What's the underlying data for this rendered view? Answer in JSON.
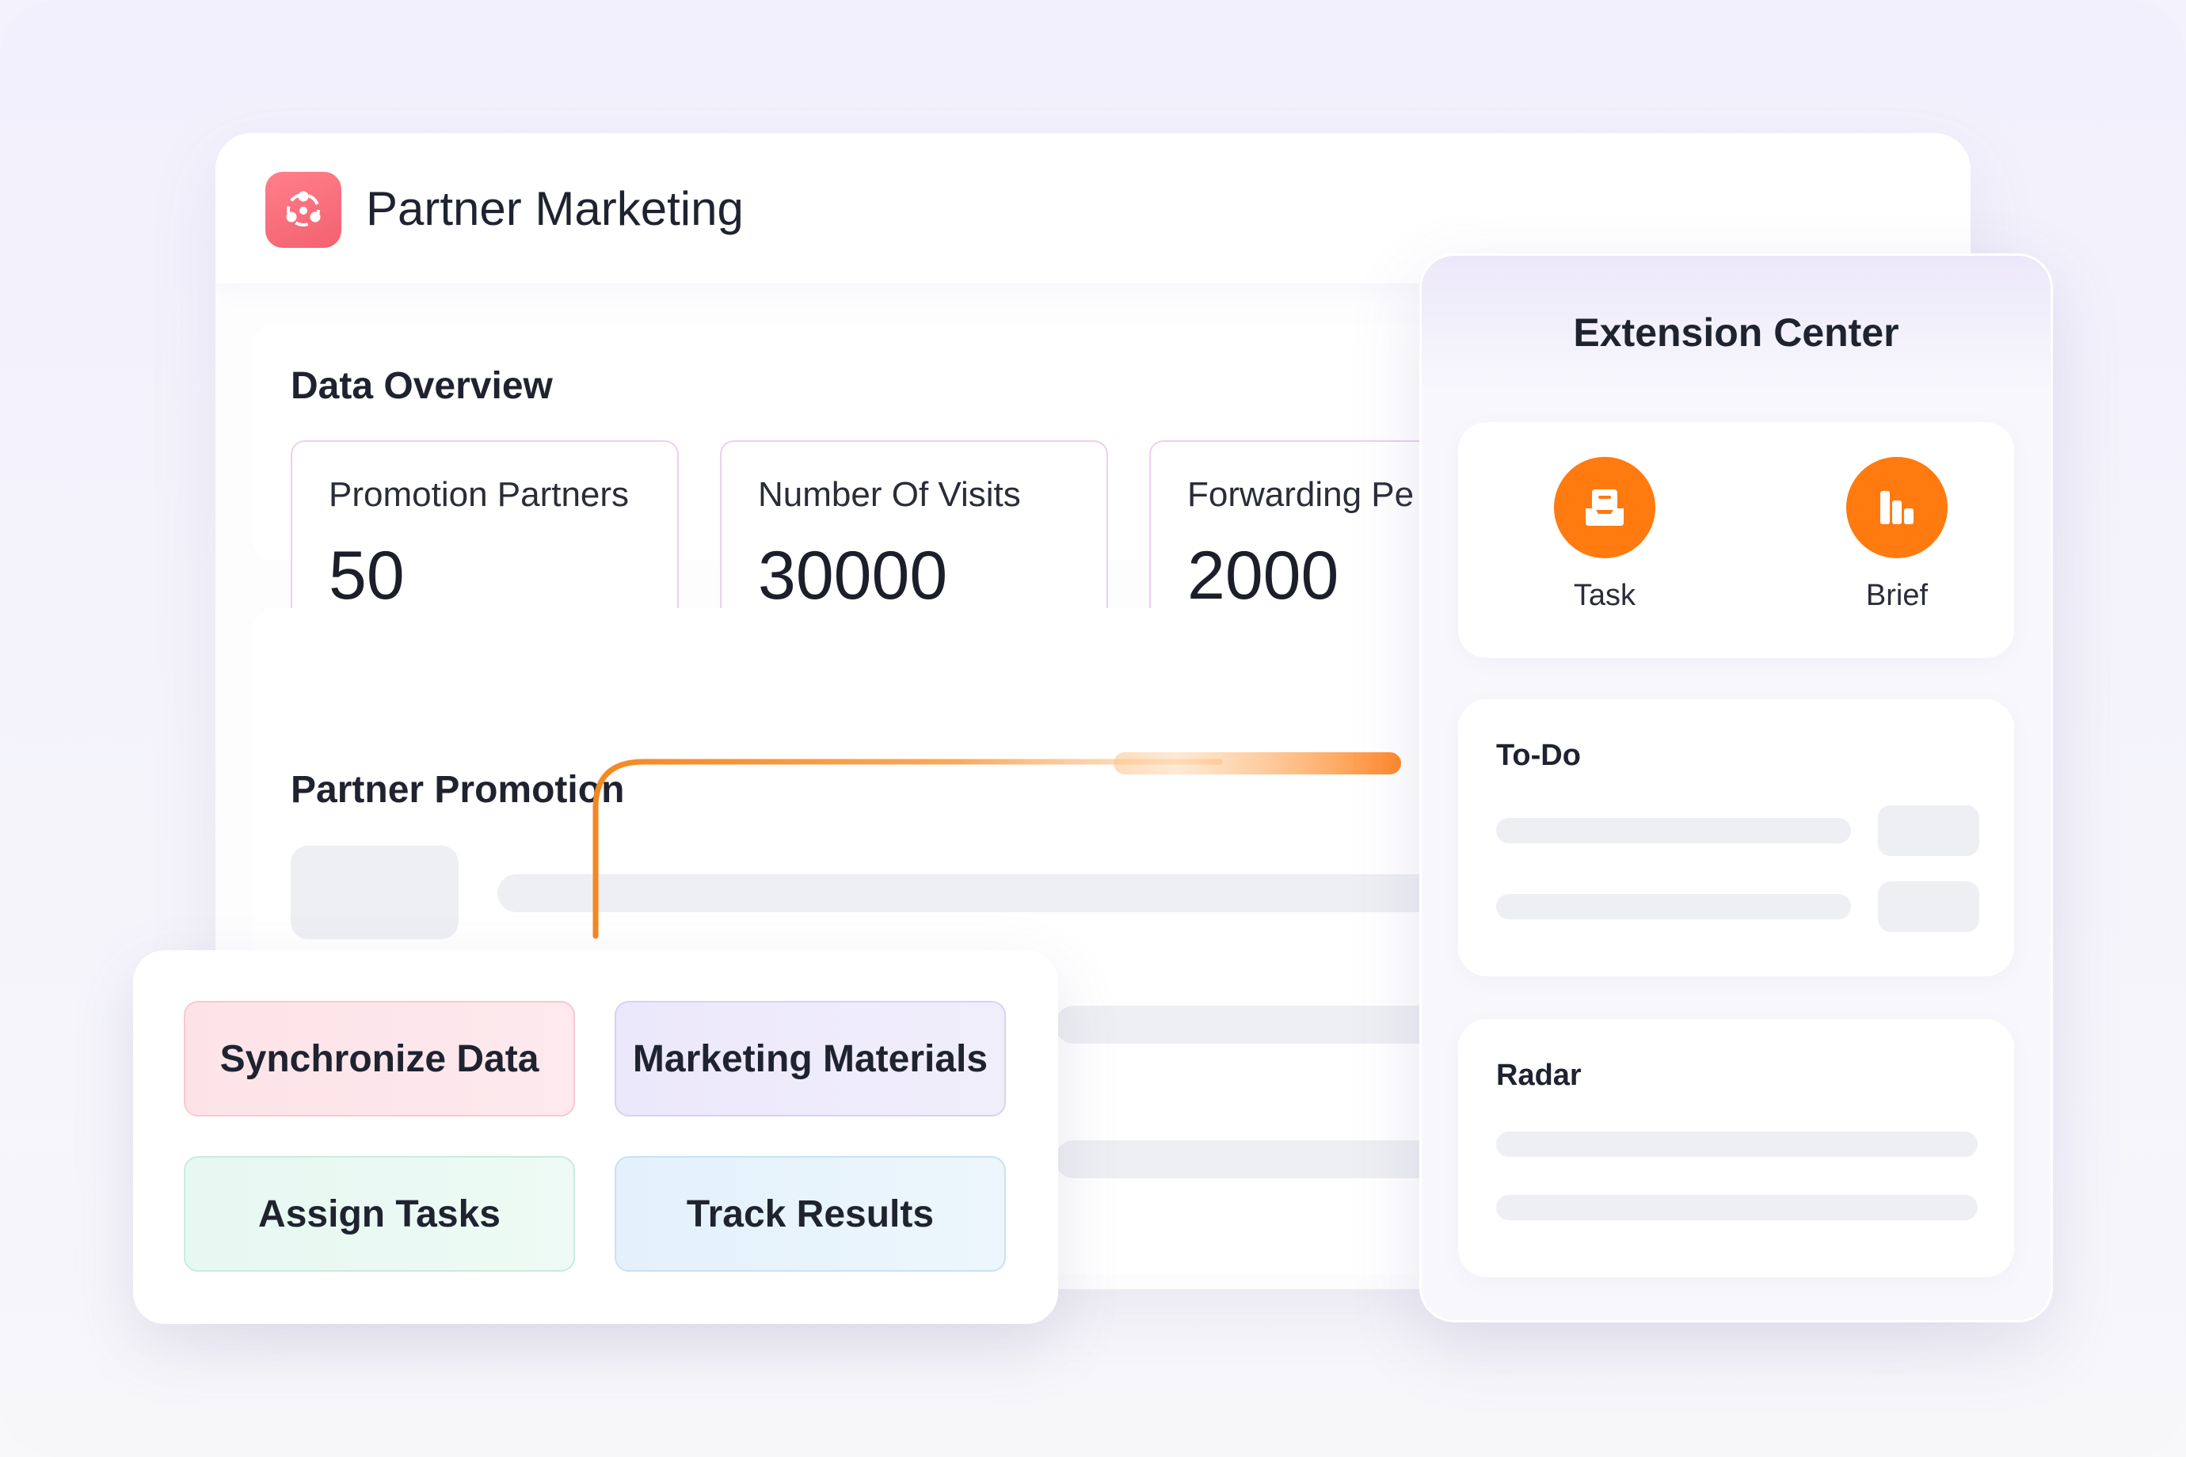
{
  "app": {
    "title": "Partner Marketing",
    "logo_icon": "partner-network-icon",
    "logo_color": "#f4616f"
  },
  "overview": {
    "title": "Data Overview",
    "stats": [
      {
        "label": "Promotion Partners",
        "value": "50"
      },
      {
        "label": "Number Of Visits",
        "value": "30000"
      },
      {
        "label": "Forwarding Pe",
        "value": "2000"
      }
    ]
  },
  "promotion": {
    "title": "Partner Promotion"
  },
  "actions": {
    "items": [
      {
        "label": "Synchronize Data"
      },
      {
        "label": "Marketing Materials"
      },
      {
        "label": "Assign Tasks"
      },
      {
        "label": "Track Results"
      }
    ]
  },
  "extension": {
    "title": "Extension Center",
    "tools": [
      {
        "label": "Task",
        "icon": "inbox-tray-icon"
      },
      {
        "label": "Brief",
        "icon": "bar-chart-icon"
      }
    ],
    "todo_title": "To-Do",
    "radar_title": "Radar",
    "accent_color": "#ff7a0f"
  }
}
